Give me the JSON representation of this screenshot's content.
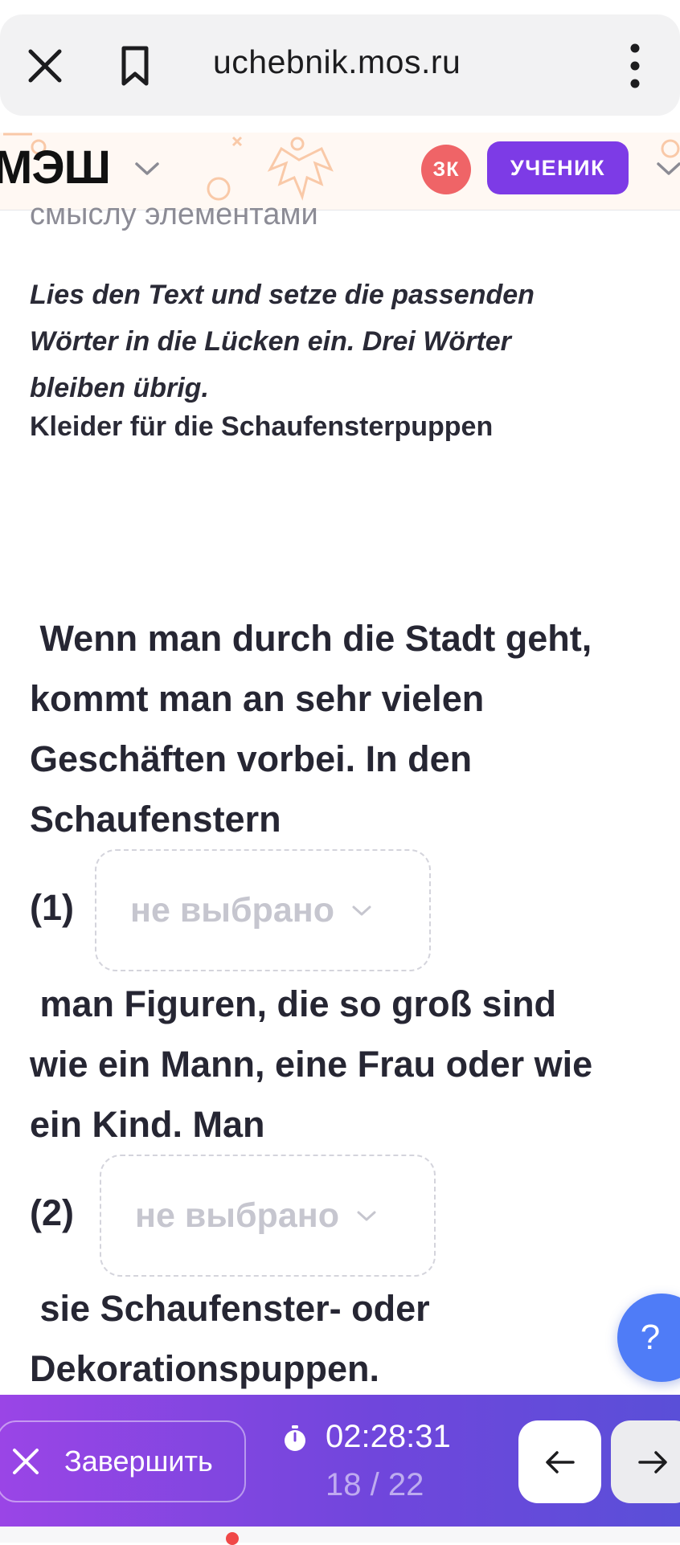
{
  "browser": {
    "url": "uchebnik.mos.ru",
    "close_icon": "close-icon",
    "bookmark_icon": "bookmark-icon",
    "menu_icon": "kebab-menu-icon"
  },
  "header": {
    "logo": "МЭШ",
    "avatar_initials": "ЗК",
    "role": "УЧЕНИК",
    "colors": {
      "avatar": "#ef6467",
      "role_badge": "#7d3be6"
    }
  },
  "content": {
    "cut_heading": "смыслу элементами",
    "instruction_lines": [
      "Lies den Text und setze die passenden",
      "Wörter in die Lücken ein. Drei Wörter",
      "bleiben übrig."
    ],
    "text_title": "Kleider für die Schaufensterpuppen",
    "paragraph_1": [
      " Wenn man durch die Stadt geht,",
      "kommt man an sehr vielen",
      "Geschäften vorbei. In den",
      "Schaufenstern"
    ],
    "gap_1": {
      "label": "(1)",
      "placeholder": "не выбрано"
    },
    "paragraph_2": [
      " man Figuren, die so groß sind",
      "wie ein Mann, eine Frau oder wie",
      "ein Kind. Man"
    ],
    "gap_2": {
      "label": "(2)",
      "placeholder": "не выбрано"
    },
    "paragraph_3": [
      " sie Schaufenster- oder",
      "Dekorationspuppen."
    ]
  },
  "help": {
    "label": "?"
  },
  "footer": {
    "finish_label": "Завершить",
    "timer": "02:28:31",
    "progress": "18 / 22",
    "timer_icon": "stopwatch-icon",
    "prev_icon": "arrow-left-icon",
    "next_icon": "arrow-right-icon",
    "colors": {
      "gradient_start": "#9a45e6",
      "gradient_end": "#5a4fd8",
      "help_button": "#4f7cf7"
    }
  }
}
